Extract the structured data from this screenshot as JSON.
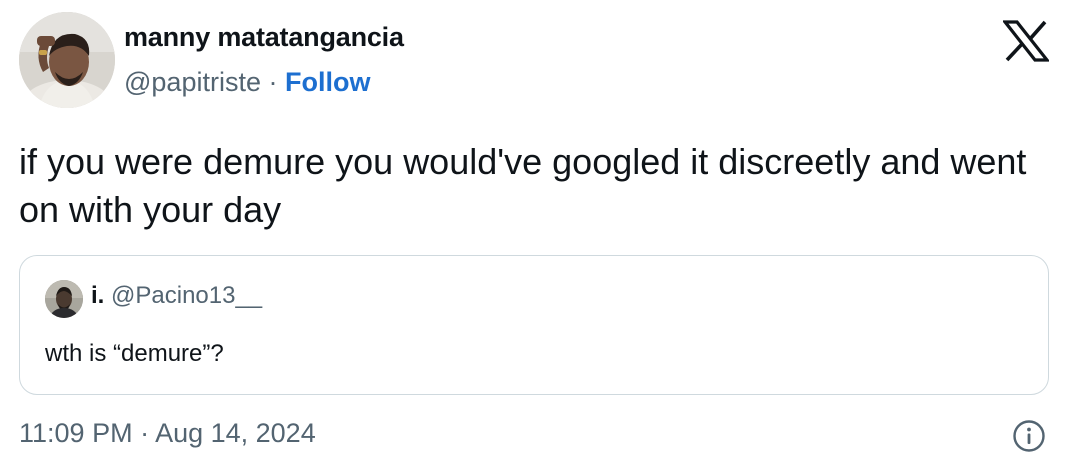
{
  "author": {
    "name": "manny matatangancia",
    "handle": "@papitriste",
    "separator": "·",
    "follow_label": "Follow"
  },
  "tweet": {
    "text": "if you were demure you would've googled it discreetly and went on with your day"
  },
  "quoted_tweet": {
    "name": "i.",
    "handle": "@Pacino13__",
    "text": "wth is “demure”?"
  },
  "meta": {
    "timestamp": "11:09 PM · Aug 14, 2024"
  },
  "icons": {
    "brand": "x-logo-icon",
    "info": "info-icon"
  },
  "colors": {
    "link": "#1d6fd0",
    "secondary_text": "#536471",
    "border": "#cfd9de"
  }
}
